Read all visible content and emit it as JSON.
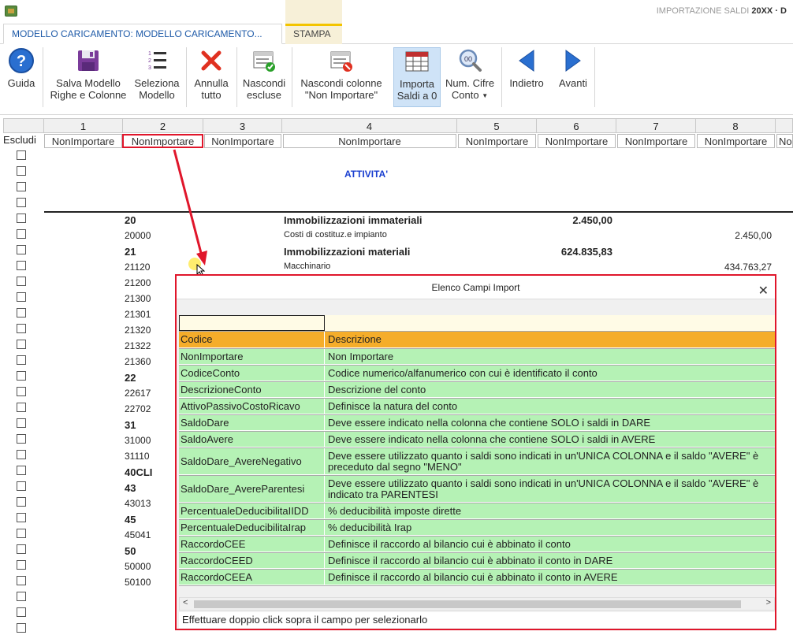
{
  "window": {
    "title_prefix": "IMPORTAZIONE SALDI",
    "title_suffix": "20XX · D"
  },
  "tabs": [
    {
      "label": "MODELLO CARICAMENTO: MODELLO CARICAMENTO..."
    },
    {
      "label": "STAMPA"
    }
  ],
  "ribbon": {
    "guida": {
      "line1": "Guida",
      "line2": ""
    },
    "salva": {
      "line1": "Salva Modello",
      "line2": "Righe e Colonne"
    },
    "seleziona": {
      "line1": "Seleziona",
      "line2": "Modello"
    },
    "annulla": {
      "line1": "Annulla",
      "line2": "tutto"
    },
    "nascondi": {
      "line1": "Nascondi",
      "line2": "escluse"
    },
    "nascondi_col": {
      "line1": "Nascondi colonne",
      "line2": "\"Non Importare\""
    },
    "importa": {
      "line1": "Importa",
      "line2": "Saldi a 0"
    },
    "numcifre": {
      "line1": "Num. Cifre",
      "line2": "Conto"
    },
    "indietro": {
      "line1": "Indietro",
      "line2": ""
    },
    "avanti": {
      "line1": "Avanti",
      "line2": ""
    }
  },
  "sheet": {
    "escludi_label": "Escludi",
    "column_numbers": [
      "1",
      "2",
      "3",
      "4",
      "5",
      "6",
      "7",
      "8"
    ],
    "column_selectors": [
      "NonImportare",
      "NonImportare",
      "NonImportare",
      "NonImportare",
      "NonImportare",
      "NonImportare",
      "NonImportare",
      "NonImportare",
      "No"
    ],
    "section_title": "ATTIVITA'",
    "rows": [
      {
        "code": "20",
        "bold": true,
        "desc": "Immobilizzazioni immateriali",
        "v1": "2.450,00",
        "v2": ""
      },
      {
        "code": "20000",
        "bold": false,
        "desc": "Costi di costituz.e impianto",
        "v1": "",
        "v2": "2.450,00"
      },
      {
        "code": "21",
        "bold": true,
        "desc": "Immobilizzazioni materiali",
        "v1": "624.835,83",
        "v2": ""
      },
      {
        "code": "21120",
        "bold": false,
        "desc": "Macchinario",
        "v1": "",
        "v2": "434.763,27"
      },
      {
        "code": "21200",
        "bold": false,
        "desc": "",
        "v1": "",
        "v2": ""
      },
      {
        "code": "21300",
        "bold": false,
        "desc": "",
        "v1": "",
        "v2": ""
      },
      {
        "code": "21301",
        "bold": false,
        "desc": "",
        "v1": "",
        "v2": ""
      },
      {
        "code": "21320",
        "bold": false,
        "desc": "",
        "v1": "",
        "v2": ""
      },
      {
        "code": "21322",
        "bold": false,
        "desc": "",
        "v1": "",
        "v2": ""
      },
      {
        "code": "21360",
        "bold": false,
        "desc": "",
        "v1": "",
        "v2": ""
      },
      {
        "code": "22",
        "bold": true,
        "desc": "",
        "v1": "",
        "v2": ""
      },
      {
        "code": "22617",
        "bold": false,
        "desc": "",
        "v1": "",
        "v2": ""
      },
      {
        "code": "22702",
        "bold": false,
        "desc": "",
        "v1": "",
        "v2": ""
      },
      {
        "code": "31",
        "bold": true,
        "desc": "",
        "v1": "",
        "v2": ""
      },
      {
        "code": "31000",
        "bold": false,
        "desc": "",
        "v1": "",
        "v2": ""
      },
      {
        "code": "31110",
        "bold": false,
        "desc": "",
        "v1": "",
        "v2": ""
      },
      {
        "code": "40CLI",
        "bold": true,
        "desc": "",
        "v1": "",
        "v2": ""
      },
      {
        "code": "43",
        "bold": true,
        "desc": "",
        "v1": "",
        "v2": ""
      },
      {
        "code": "43013",
        "bold": false,
        "desc": "",
        "v1": "",
        "v2": ""
      },
      {
        "code": "45",
        "bold": true,
        "desc": "",
        "v1": "",
        "v2": ""
      },
      {
        "code": "45041",
        "bold": false,
        "desc": "",
        "v1": "",
        "v2": ""
      },
      {
        "code": "50",
        "bold": true,
        "desc": "",
        "v1": "",
        "v2": ""
      },
      {
        "code": "50000",
        "bold": false,
        "desc": "",
        "v1": "",
        "v2": ""
      },
      {
        "code": "50100",
        "bold": false,
        "desc": "",
        "v1": "",
        "v2": ""
      }
    ]
  },
  "popup": {
    "title": "Elenco Campi Import",
    "close": "✕",
    "filter_codice": "",
    "filter_descrizione": "",
    "headers": {
      "codice": "Codice",
      "descrizione": "Descrizione"
    },
    "items": [
      {
        "codice": "NonImportare",
        "descrizione": "Non Importare",
        "descrizione2": ""
      },
      {
        "codice": "CodiceConto",
        "descrizione": "Codice numerico/alfanumerico con cui è identificato il conto",
        "descrizione2": ""
      },
      {
        "codice": "DescrizioneConto",
        "descrizione": "Descrizione del conto",
        "descrizione2": ""
      },
      {
        "codice": "AttivoPassivoCostoRicavo",
        "descrizione": "Definisce la natura del conto",
        "descrizione2": ""
      },
      {
        "codice": "SaldoDare",
        "descrizione": "Deve essere indicato nella colonna che contiene SOLO i saldi in DARE",
        "descrizione2": ""
      },
      {
        "codice": "SaldoAvere",
        "descrizione": "Deve essere indicato nella colonna che contiene SOLO i saldi in AVERE",
        "descrizione2": ""
      },
      {
        "codice": "SaldoDare_AvereNegativo",
        "descrizione": "Deve essere utilizzato quanto i saldi sono indicati in un'UNICA COLONNA e il saldo \"AVERE\" è",
        "descrizione2": "preceduto dal segno \"MENO\""
      },
      {
        "codice": "SaldoDare_AvereParentesi",
        "descrizione": "Deve essere utilizzato quanto i saldi sono indicati in un'UNICA COLONNA e il saldo \"AVERE\" è",
        "descrizione2": "indicato tra PARENTESI"
      },
      {
        "codice": "PercentualeDeducibilitaIIDD",
        "descrizione": "% deducibilità imposte dirette",
        "descrizione2": ""
      },
      {
        "codice": "PercentualeDeducibilitaIrap",
        "descrizione": "% deducibilità Irap",
        "descrizione2": ""
      },
      {
        "codice": "RaccordoCEE",
        "descrizione": "Definisce il raccordo al bilancio cui è abbinato il conto",
        "descrizione2": ""
      },
      {
        "codice": "RaccordoCEED",
        "descrizione": "Definisce il raccordo al bilancio cui è abbinato il conto in DARE",
        "descrizione2": ""
      },
      {
        "codice": "RaccordoCEEA",
        "descrizione": "Definisce il raccordo al bilancio cui è abbinato il conto in AVERE",
        "descrizione2": ""
      }
    ],
    "scroll_left": "<",
    "scroll_right": ">",
    "footer": "Effettuare doppio click sopra il campo per selezionarlo"
  },
  "colors": {
    "accent_red": "#e0162b",
    "header_orange": "#f5ad2a",
    "row_green": "#b5f2b5",
    "tab_blue": "#1e5aa8"
  }
}
